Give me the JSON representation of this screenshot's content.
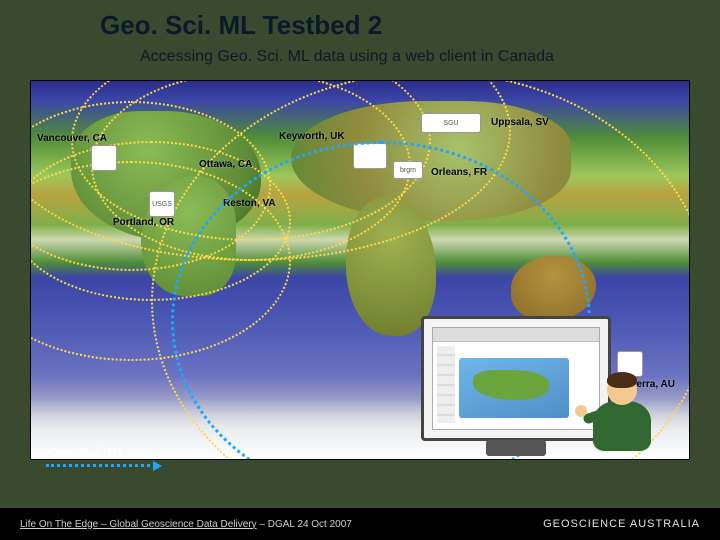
{
  "title": "Geo. Sci. ML Testbed 2",
  "subtitle": "Accessing Geo. Sci. ML data using a web client in Canada",
  "nodes": {
    "vancouver": "Vancouver, CA",
    "portland": "Portland, OR",
    "reston": "Reston, VA",
    "ottawa": "Ottawa, CA",
    "keyworth": "Keyworth, UK",
    "uppsala": "Uppsala, SV",
    "orleans": "Orleans, FR",
    "canberra": "Canberra, AU"
  },
  "badge": "Geo. Sci. ML",
  "footer_left_link": "Life On The Edge – Global Geoscience Data Delivery",
  "footer_left_suffix": " – DGAL 24 Oct 2007",
  "footer_brand": "GEOSCIENCE AUSTRALIA"
}
